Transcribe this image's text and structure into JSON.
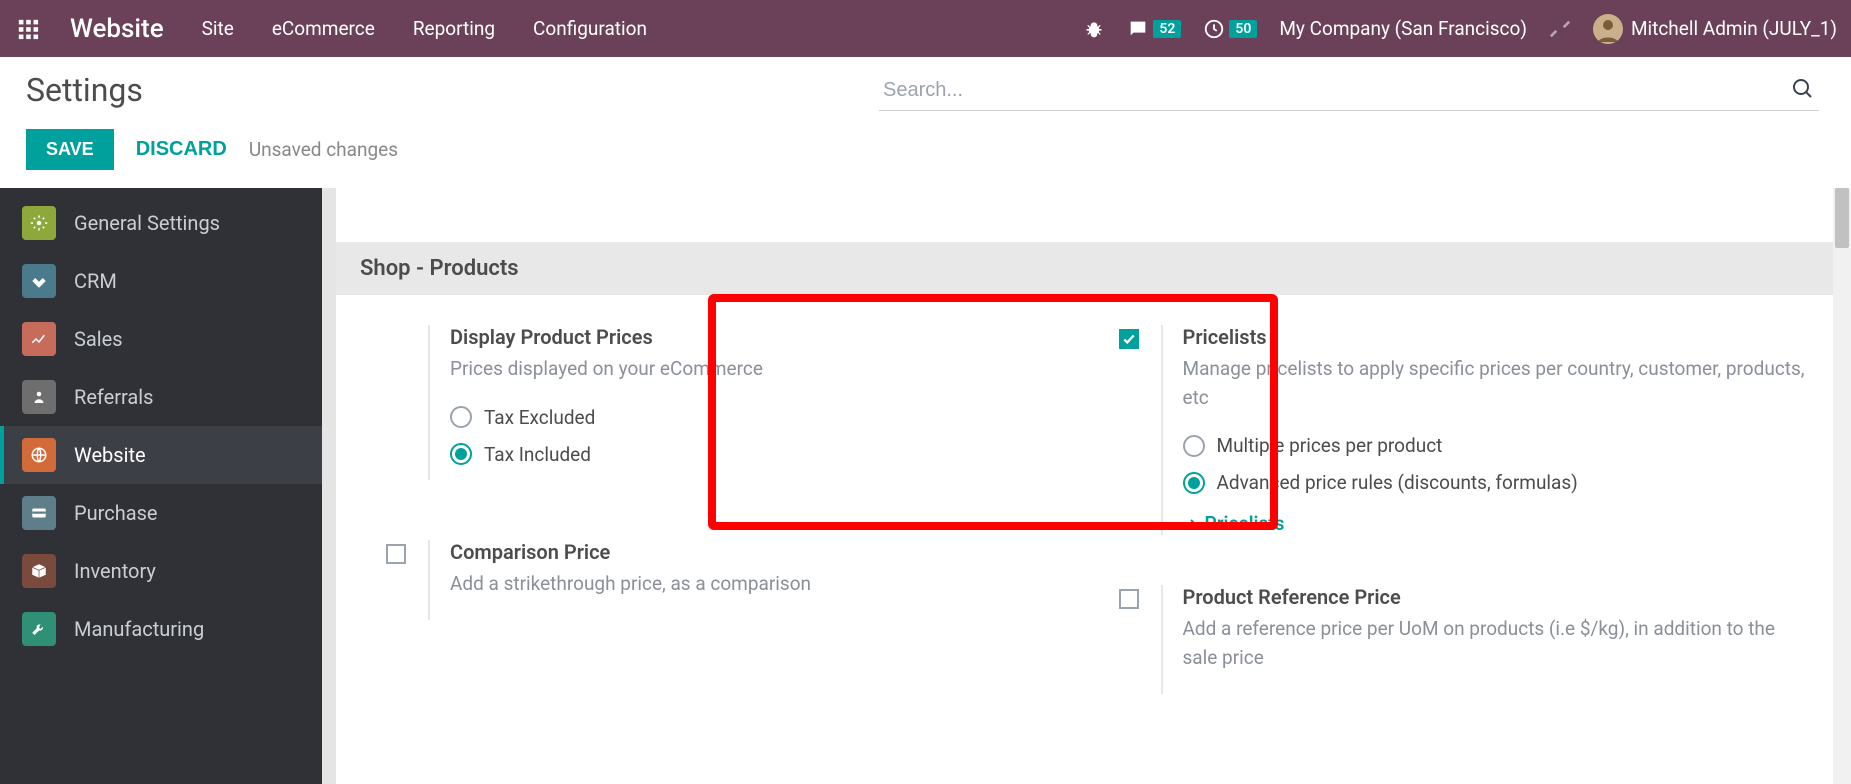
{
  "topbar": {
    "brand": "Website",
    "menu": [
      "Site",
      "eCommerce",
      "Reporting",
      "Configuration"
    ],
    "messages_badge": "52",
    "activities_badge": "50",
    "company": "My Company (San Francisco)",
    "user": "Mitchell Admin (JULY_1)"
  },
  "header": {
    "page_title": "Settings",
    "search_placeholder": "Search..."
  },
  "actions": {
    "save": "SAVE",
    "discard": "DISCARD",
    "status": "Unsaved changes"
  },
  "sidebar": {
    "items": [
      {
        "label": "General Settings"
      },
      {
        "label": "CRM"
      },
      {
        "label": "Sales"
      },
      {
        "label": "Referrals"
      },
      {
        "label": "Website"
      },
      {
        "label": "Purchase"
      },
      {
        "label": "Inventory"
      },
      {
        "label": "Manufacturing"
      }
    ],
    "active_index": 4
  },
  "section": {
    "title": "Shop - Products"
  },
  "settings": {
    "display_prices": {
      "title": "Display Product Prices",
      "desc": "Prices displayed on your eCommerce",
      "opt_excluded": "Tax Excluded",
      "opt_included": "Tax Included",
      "selected": "included"
    },
    "pricelists": {
      "title": "Pricelists",
      "desc": "Manage pricelists to apply specific prices per country, customer, products, etc",
      "enabled": true,
      "opt_multiple": "Multiple prices per product",
      "opt_advanced": "Advanced price rules (discounts, formulas)",
      "selected": "advanced",
      "link": "Pricelists"
    },
    "comparison": {
      "title": "Comparison Price",
      "desc": "Add a strikethrough price, as a comparison",
      "enabled": false
    },
    "reference": {
      "title": "Product Reference Price",
      "desc": "Add a reference price per UoM on products (i.e $/kg), in addition to the sale price",
      "enabled": false
    }
  }
}
